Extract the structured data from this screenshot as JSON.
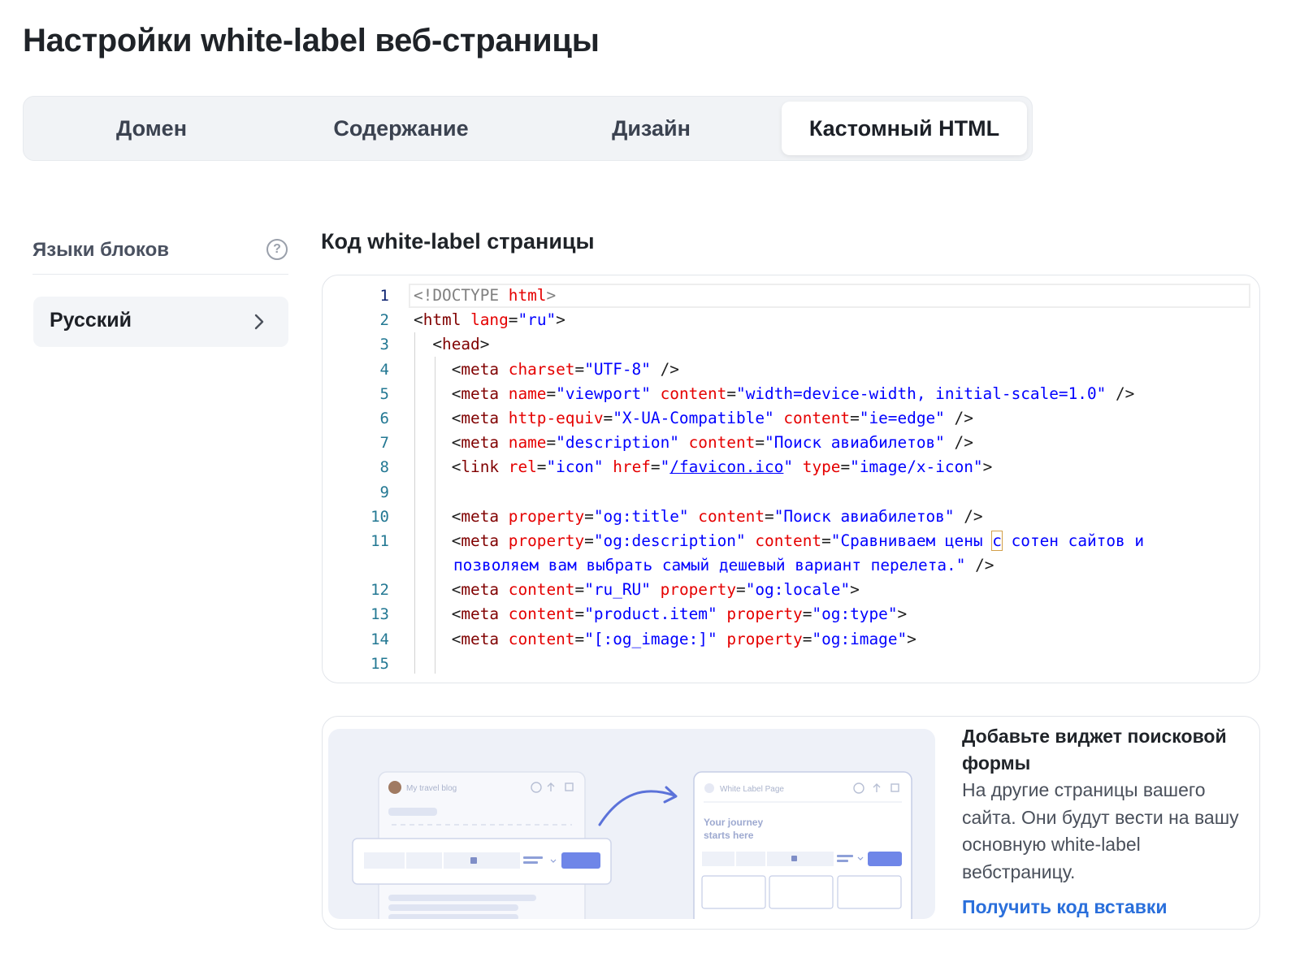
{
  "page": {
    "title": "Настройки white-label веб-страницы"
  },
  "tabs": [
    {
      "label": "Домен",
      "active": false
    },
    {
      "label": "Содержание",
      "active": false
    },
    {
      "label": "Дизайн",
      "active": false
    },
    {
      "label": "Кастомный HTML",
      "active": true
    }
  ],
  "sidebar": {
    "title": "Языки блоков",
    "help_icon": "question-circle-icon",
    "languages": [
      {
        "label": "Русский",
        "icon": "chevron-right-icon"
      }
    ]
  },
  "editor": {
    "title": "Код white-label страницы",
    "line_numbers": [
      "1",
      "2",
      "3",
      "4",
      "5",
      "6",
      "7",
      "8",
      "9",
      "10",
      "11",
      "12",
      "13",
      "14",
      "15"
    ],
    "lines": [
      "<!DOCTYPE html>",
      "<html lang=\"ru\">",
      "  <head>",
      "    <meta charset=\"UTF-8\" />",
      "    <meta name=\"viewport\" content=\"width=device-width, initial-scale=1.0\" />",
      "    <meta http-equiv=\"X-UA-Compatible\" content=\"ie=edge\" />",
      "    <meta name=\"description\" content=\"Поиск авиабилетов\" />",
      "    <link rel=\"icon\" href=\"/favicon.ico\" type=\"image/x-icon\">",
      "",
      "    <meta property=\"og:title\" content=\"Поиск авиабилетов\" />",
      "    <meta property=\"og:description\" content=\"Сравниваем цены с сотен сайтов и позволяем вам выбрать самый дешевый вариант перелета.\" />",
      "    <meta content=\"ru_RU\" property=\"og:locale\">",
      "    <meta content=\"product.item\" property=\"og:type\">",
      "    <meta content=\"[:og_image:]\" property=\"og:image\">",
      ""
    ]
  },
  "widget": {
    "title": "Добавьте виджет поисковой формы",
    "description": "На другие страницы вашего сайта. Они будут вести на вашу основную white-label вебстраницу.",
    "link": "Получить код вставки",
    "illustration": {
      "left_window_label": "My travel blog",
      "right_window_label": "White Label Page",
      "right_heading_1": "Your journey",
      "right_heading_2": "starts here"
    }
  },
  "colors": {
    "accent": "#2a6fdb",
    "tab_bg": "#f1f3f6",
    "button_fill": "#6f86e8"
  }
}
